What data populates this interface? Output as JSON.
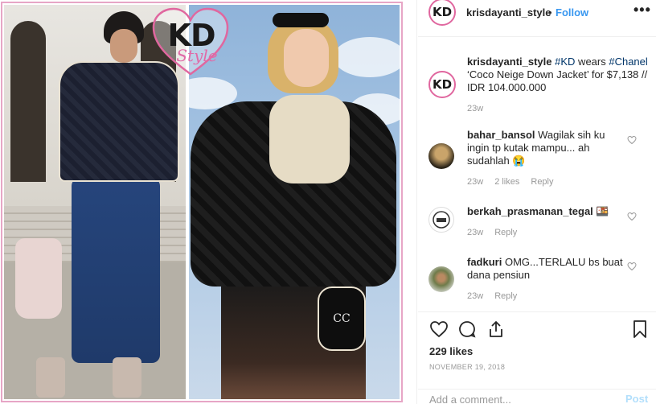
{
  "post_image": {
    "logo_letters": "KD",
    "logo_script": "Style",
    "glove_logo": "CC"
  },
  "header": {
    "username": "krisdayanti_style",
    "separator": "•",
    "follow_label": "Follow",
    "more_label": "•••"
  },
  "caption": {
    "username": "krisdayanti_style",
    "hashtag1": "#KD",
    "text1": " wears ",
    "hashtag2": "#Chanel",
    "text2": " ‘Coco Neige Down Jacket’ for $7,138 // IDR 104.000.000",
    "age": "23w"
  },
  "comments": [
    {
      "username": "bahar_bansol",
      "text": " Wagilak sih ku ingin tp kutak mampu... ah sudahlah 😭",
      "age": "23w",
      "likes": "2 likes",
      "reply": "Reply"
    },
    {
      "username": "berkah_prasmanan_tegal",
      "text": " 🍱",
      "age": "23w",
      "reply": "Reply"
    },
    {
      "username": "fadkuri",
      "text": " OMG...TERLALU bs buat dana pensiun",
      "age": "23w",
      "reply": "Reply"
    }
  ],
  "actions": {
    "likes": "229 likes",
    "date": "NOVEMBER 19, 2018"
  },
  "comment_box": {
    "placeholder": "Add a comment...",
    "post_label": "Post"
  },
  "colors": {
    "accent": "#3897f0",
    "logo_pink": "#e0679f",
    "hashtag": "#003569"
  }
}
